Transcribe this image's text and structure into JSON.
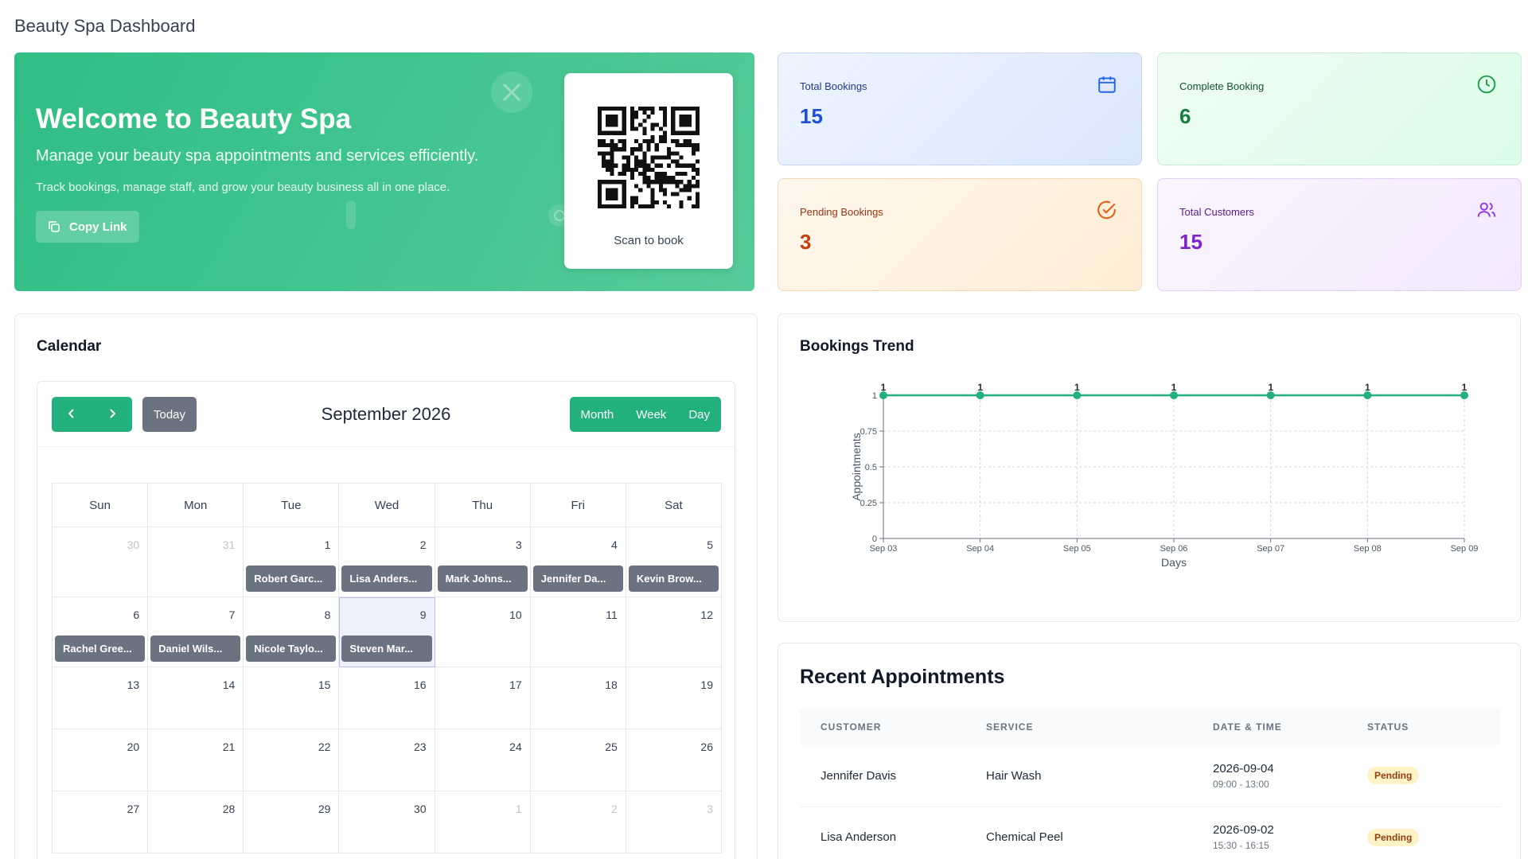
{
  "page_title": "Beauty Spa Dashboard",
  "welcome": {
    "title": "Welcome to Beauty Spa",
    "subtitle": "Manage your beauty spa appointments and services efficiently.",
    "description": "Track bookings, manage staff, and grow your beauty business all in one place.",
    "copy_label": "Copy Link",
    "qr_caption": "Scan to book"
  },
  "stats": {
    "total_bookings": {
      "label": "Total Bookings",
      "value": "15",
      "icon": "calendar-icon"
    },
    "complete_booking": {
      "label": "Complete Booking",
      "value": "6",
      "icon": "clock-icon"
    },
    "pending_bookings": {
      "label": "Pending Bookings",
      "value": "3",
      "icon": "check-circle-icon"
    },
    "total_customers": {
      "label": "Total Customers",
      "value": "15",
      "icon": "users-icon"
    }
  },
  "colors": {
    "accent": "#22b07d",
    "event": "#6b7280"
  },
  "calendar": {
    "title": "Calendar",
    "month_label": "September 2026",
    "today_label": "Today",
    "views": [
      "Month",
      "Week",
      "Day"
    ],
    "weekdays": [
      "Sun",
      "Mon",
      "Tue",
      "Wed",
      "Thu",
      "Fri",
      "Sat"
    ],
    "weeks": [
      [
        {
          "d": "30",
          "other": true
        },
        {
          "d": "31",
          "other": true
        },
        {
          "d": "1",
          "event": "Robert Garc..."
        },
        {
          "d": "2",
          "event": "Lisa Anders..."
        },
        {
          "d": "3",
          "event": "Mark Johns..."
        },
        {
          "d": "4",
          "event": "Jennifer Da..."
        },
        {
          "d": "5",
          "event": "Kevin Brow..."
        }
      ],
      [
        {
          "d": "6",
          "event": "Rachel Gree..."
        },
        {
          "d": "7",
          "event": "Daniel Wils..."
        },
        {
          "d": "8",
          "event": "Nicole Taylo..."
        },
        {
          "d": "9",
          "event": "Steven Mar...",
          "today": true
        },
        {
          "d": "10"
        },
        {
          "d": "11"
        },
        {
          "d": "12"
        }
      ],
      [
        {
          "d": "13"
        },
        {
          "d": "14"
        },
        {
          "d": "15"
        },
        {
          "d": "16"
        },
        {
          "d": "17"
        },
        {
          "d": "18"
        },
        {
          "d": "19"
        }
      ],
      [
        {
          "d": "20"
        },
        {
          "d": "21"
        },
        {
          "d": "22"
        },
        {
          "d": "23"
        },
        {
          "d": "24"
        },
        {
          "d": "25"
        },
        {
          "d": "26"
        }
      ],
      [
        {
          "d": "27"
        },
        {
          "d": "28"
        },
        {
          "d": "29"
        },
        {
          "d": "30"
        },
        {
          "d": "1",
          "other": true
        },
        {
          "d": "2",
          "other": true
        },
        {
          "d": "3",
          "other": true
        }
      ]
    ]
  },
  "trend": {
    "title": "Bookings Trend"
  },
  "chart_data": {
    "type": "line",
    "title": "Bookings Trend",
    "xlabel": "Days",
    "ylabel": "Appointments",
    "x": [
      "Sep 03",
      "Sep 04",
      "Sep 05",
      "Sep 06",
      "Sep 07",
      "Sep 08",
      "Sep 09"
    ],
    "series": [
      {
        "values": [
          1,
          1,
          1,
          1,
          1,
          1,
          1
        ]
      }
    ],
    "ylim": [
      0,
      1
    ],
    "yticks": [
      "0",
      "0.25",
      "0.5",
      "0.75",
      "1"
    ],
    "point_labels": [
      "1",
      "1",
      "1",
      "1",
      "1",
      "1",
      "1"
    ],
    "grid": true,
    "color": "#22b07d"
  },
  "recent": {
    "title": "Recent Appointments",
    "columns": [
      "CUSTOMER",
      "SERVICE",
      "DATE & TIME",
      "STATUS"
    ],
    "rows": [
      {
        "customer": "Jennifer Davis",
        "service": "Hair Wash",
        "date": "2026-09-04",
        "time": "09:00 - 13:00",
        "status": "Pending"
      },
      {
        "customer": "Lisa Anderson",
        "service": "Chemical Peel",
        "date": "2026-09-02",
        "time": "15:30 - 16:15",
        "status": "Pending"
      }
    ]
  }
}
